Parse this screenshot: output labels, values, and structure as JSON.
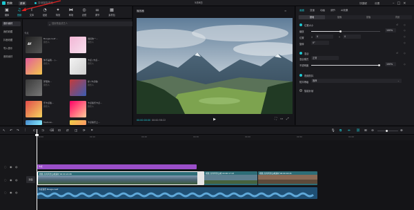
{
  "titlebar": {
    "app_name": "剪映",
    "menu_label": "菜单",
    "status_text": "自动保存本地",
    "project_title": "5月8日",
    "right_items": [
      "快捷键",
      "设置"
    ]
  },
  "resource_tabs": [
    {
      "label": "媒体",
      "icon": "media-icon"
    },
    {
      "label": "音频",
      "icon": "audio-icon"
    },
    {
      "label": "文本",
      "icon": "text-icon"
    },
    {
      "label": "贴纸",
      "icon": "sticker-icon"
    },
    {
      "label": "特效",
      "icon": "effects-icon"
    },
    {
      "label": "转场",
      "icon": "transition-icon"
    },
    {
      "label": "滤镜",
      "icon": "filter-icon"
    },
    {
      "label": "调节",
      "icon": "adjust-icon"
    },
    {
      "label": "素材包",
      "icon": "package-icon"
    }
  ],
  "left_nav": [
    "音乐素材",
    "我的收藏",
    "抖音收藏",
    "导入音乐",
    "音效素材"
  ],
  "media": {
    "search_placeholder": "搜索歌曲或艺人",
    "section_label": "卡点",
    "items": [
      {
        "title": "Boogie Gulf ...",
        "artist": "音乐人"
      },
      {
        "title": "说好的一...",
        "artist": "音乐人"
      },
      {
        "title": "你不是我... (...",
        "artist": "音乐人"
      },
      {
        "title": "卡点 (卡点...",
        "artist": "音乐人"
      },
      {
        "title": "梦里的...",
        "artist": "音乐人"
      },
      {
        "title": "摩 (卡点版)",
        "artist": "音乐人"
      },
      {
        "title": "乐卡点版...",
        "artist": "音乐人"
      },
      {
        "title": "卡点版乐卡点...",
        "artist": "音乐人"
      },
      {
        "title": "Festival...",
        "artist": "音乐人"
      },
      {
        "title": "卡点版乐上...",
        "artist": "音乐人"
      }
    ]
  },
  "player": {
    "title": "播放器",
    "timecode": "00:00:00:00",
    "duration": "00:00:58:22"
  },
  "inspector": {
    "tabs": [
      "画面",
      "变速",
      "动画",
      "调节",
      "AI效果"
    ],
    "subtabs": [
      "基础",
      "抠像",
      "蒙版",
      "背景"
    ],
    "section_position": "位置大小",
    "scale_label": "缩放",
    "scale_value": "100%",
    "position_label": "位置",
    "position_x": "0",
    "position_y": "0",
    "rotate_label": "旋转",
    "rotate_value": "0°",
    "section_blend": "混合",
    "blend_mode_label": "混合模式",
    "blend_mode_value": "正常",
    "opacity_label": "不透明度",
    "opacity_value": "100%",
    "section_stabilize": "视频防抖",
    "stabilize_label": "防抖等级",
    "stabilize_value": "推荐",
    "section_smart": "智能补帧"
  },
  "timeline": {
    "ruler": [
      "00:00",
      "00:10",
      "00:20",
      "00:30",
      "00:40",
      "00:50",
      "01:00"
    ],
    "track_head_label": "封面",
    "effect_label": "卡点",
    "video_clips": [
      {
        "label": "视频 高清风景山峰素材 00:00:24:08"
      },
      {
        "label": "视频 高清风景山峰 00:00:17:23"
      },
      {
        "label": "视频 高清风景山峰素材 00:00:16:21"
      }
    ],
    "audio_label": "卡点音乐 Boogie Gulf"
  }
}
